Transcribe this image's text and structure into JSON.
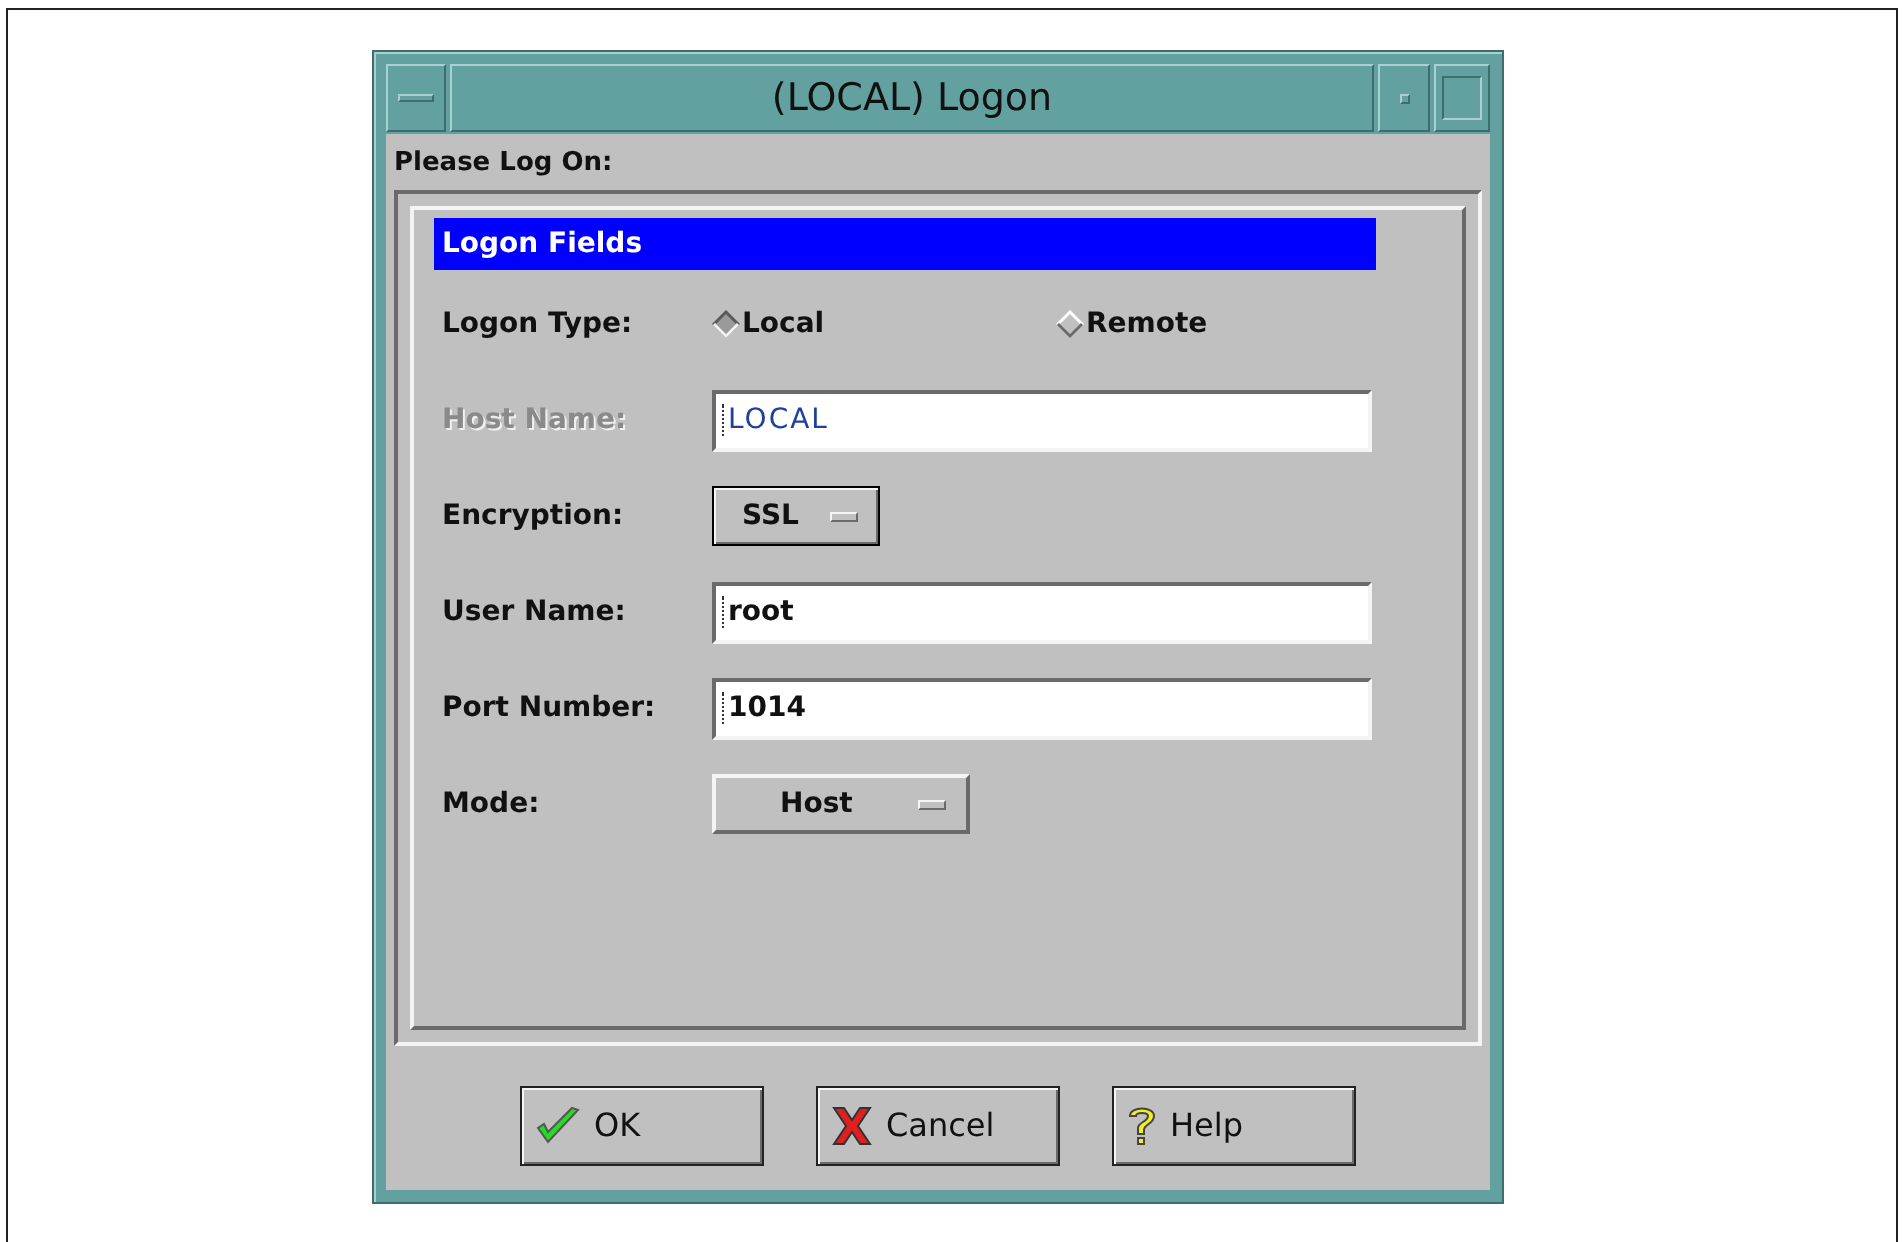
{
  "window": {
    "title": "(LOCAL) Logon"
  },
  "prompt": "Please Log On:",
  "group": {
    "title": "Logon Fields",
    "fields": [
      {
        "kind": "radio",
        "label": "Logon Type:",
        "options": [
          {
            "label": "Local",
            "selected": true
          },
          {
            "label": "Remote",
            "selected": false
          }
        ]
      },
      {
        "kind": "text",
        "label": "Host Name:",
        "value": "LOCAL",
        "disabled": true
      },
      {
        "kind": "option",
        "label": "Encryption:",
        "value": "SSL",
        "wide": false
      },
      {
        "kind": "text",
        "label": "User Name:",
        "value": "root",
        "disabled": false
      },
      {
        "kind": "text",
        "label": "Port Number:",
        "value": "1014",
        "disabled": false
      },
      {
        "kind": "option",
        "label": "Mode:",
        "value": "Host",
        "wide": true
      }
    ]
  },
  "buttons": [
    {
      "kind": "ok",
      "label": "OK"
    },
    {
      "kind": "cancel",
      "label": "Cancel"
    },
    {
      "kind": "help",
      "label": "Help"
    }
  ]
}
